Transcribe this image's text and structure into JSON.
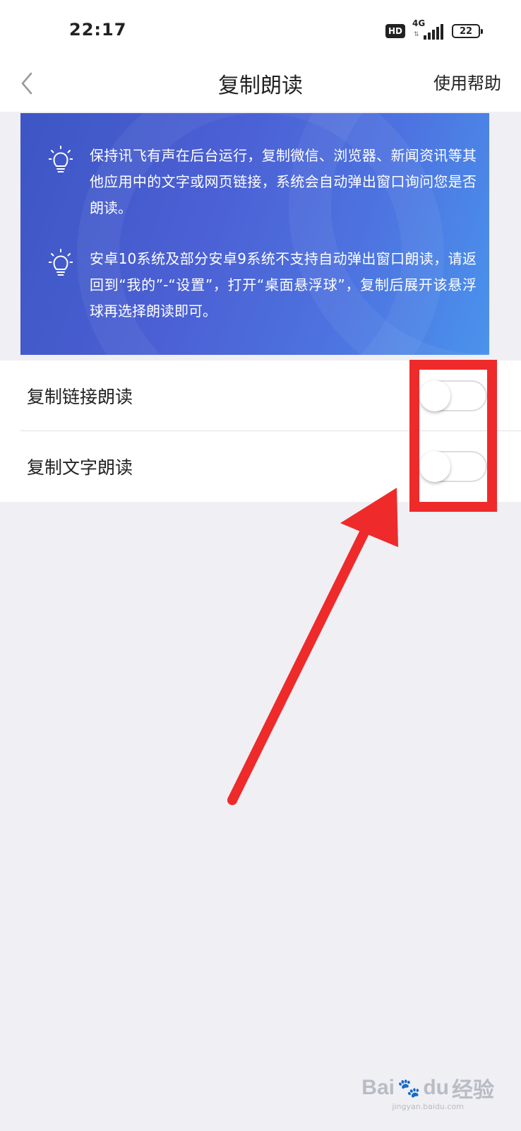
{
  "status_bar": {
    "time": "22:17",
    "hd": "HD",
    "network": "4G",
    "battery": "22"
  },
  "header": {
    "title": "复制朗读",
    "help_label": "使用帮助"
  },
  "banner": {
    "tips": [
      "保持讯飞有声在后台运行，复制微信、浏览器、新闻资讯等其他应用中的文字或网页链接，系统会自动弹出窗口询问您是否朗读。",
      "安卓10系统及部分安卓9系统不支持自动弹出窗口朗读，请返回到“我的”-“设置”，打开“桌面悬浮球”，复制后展开该悬浮球再选择朗读即可。"
    ]
  },
  "settings": [
    {
      "label": "复制链接朗读",
      "enabled": false
    },
    {
      "label": "复制文字朗读",
      "enabled": false
    }
  ],
  "watermark": {
    "text": "Bai",
    "text2": "du",
    "text3": "经验",
    "sub": "jingyan.baidu.com"
  },
  "colors": {
    "annotation": "#ee2a2a",
    "banner_start": "#3d56c4",
    "banner_end": "#4a93ec"
  }
}
